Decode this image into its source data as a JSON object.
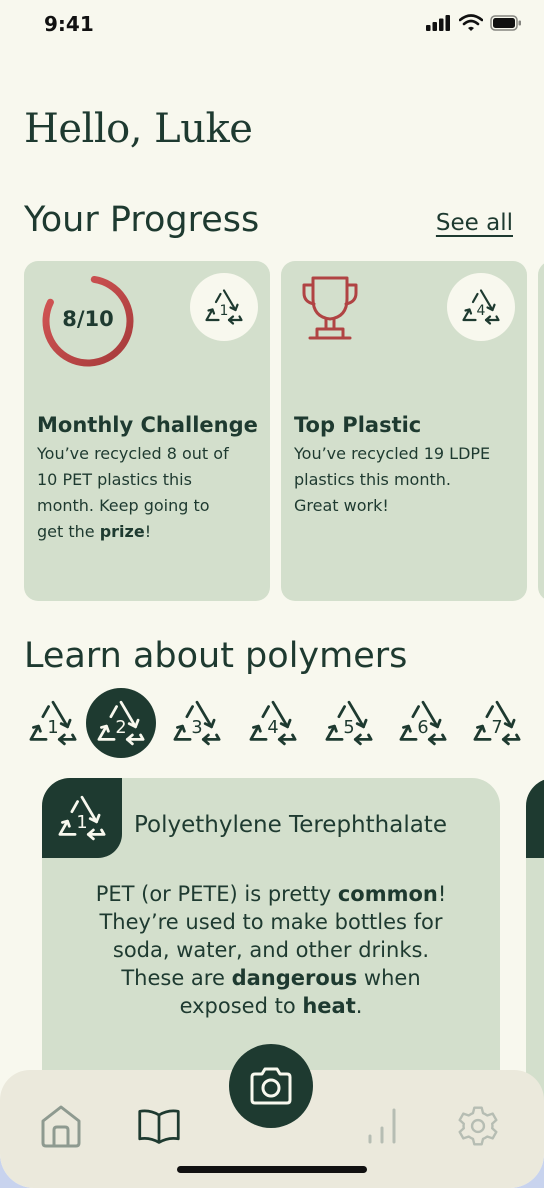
{
  "status_bar": {
    "time": "9:41"
  },
  "greeting": "Hello, Luke",
  "progress": {
    "title": "Your Progress",
    "see_all": "See all",
    "cards": [
      {
        "ring_label": "8/10",
        "ring_fraction": 0.8,
        "badge_number": "1",
        "title": "Monthly Challenge",
        "text_before": "You’ve recycled 8 out of 10 PET plastics this month. Keep going to get the ",
        "text_bold": "prize",
        "text_after": "!"
      },
      {
        "badge_number": "4",
        "title": "Top Plastic",
        "text": "You’ve recycled 19 LDPE plastics this month. Great work!"
      }
    ]
  },
  "polymers": {
    "title": "Learn about polymers",
    "numbers": [
      "1",
      "2",
      "3",
      "4",
      "5",
      "6",
      "7"
    ],
    "selected": "2",
    "detail": {
      "number": "1",
      "name": "Polyethylene Terephthalate",
      "seg1": "PET (or PETE) is pretty ",
      "bold1": "common",
      "seg2": "! They’re used to make bottles for soda, water, and other drinks. These are ",
      "bold2": "dangerous",
      "seg3": " when exposed to ",
      "bold3": "heat",
      "seg4": "."
    }
  },
  "tabbar": {
    "items": [
      "home-icon",
      "book-icon",
      "camera-icon",
      "chart-icon",
      "gear-icon"
    ],
    "active": "book-icon"
  },
  "colors": {
    "background": "#f8f8ee",
    "primary": "#1e3a30",
    "card": "#d3dfcc",
    "accent_red": "#b04343",
    "tabbar": "#ebe9dc"
  }
}
